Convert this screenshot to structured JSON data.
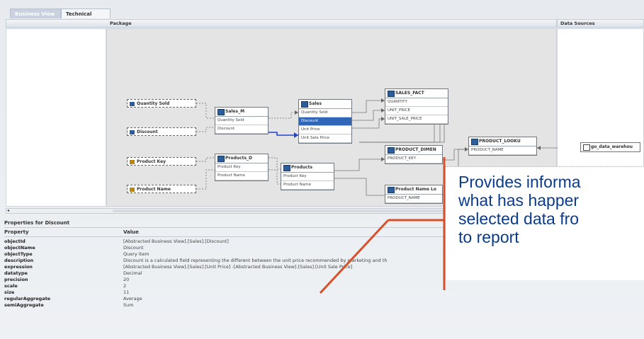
{
  "tabs": [
    {
      "label": "Business View"
    },
    {
      "label": "Technical View"
    }
  ],
  "headers": {
    "package": "Package",
    "data_sources": "Data Sources"
  },
  "query_items": [
    "Quantity Sold",
    "Discount",
    "Product Key",
    "Product Name"
  ],
  "nodes": {
    "sales_m": {
      "title": "Sales_M",
      "rows": [
        "Quantity Sold",
        "Discount"
      ]
    },
    "sales": {
      "title": "Sales",
      "rows": [
        "Quantity Sold",
        "Discount",
        "Unit Price",
        "Unit Sale Price"
      ]
    },
    "sales_fact": {
      "title": "SALES_FACT",
      "rows": [
        "QUANTITY",
        "UNIT_PRICE",
        "UNIT_SALE_PRICE"
      ]
    },
    "products_d": {
      "title": "Products_D",
      "rows": [
        "Product Key",
        "Product Name"
      ]
    },
    "products": {
      "title": "Products",
      "rows": [
        "Product Key",
        "Product Name"
      ]
    },
    "product_dimen": {
      "title": "PRODUCT_DIMEN",
      "rows": [
        "PRODUCT_KEY"
      ]
    },
    "product_name_lo": {
      "title": "Product Name Lo",
      "rows": [
        "PRODUCT_NAME"
      ]
    },
    "product_looku": {
      "title": "PRODUCT_LOOKU",
      "rows": [
        "PRODUCT_NAME"
      ]
    },
    "go_data_warehou": {
      "title": "go_data_warehou"
    }
  },
  "properties": {
    "title": "Properties for Discount",
    "col_property": "Property",
    "col_value": "Value",
    "rows": [
      {
        "k": "objectId",
        "v": "[Abstracted Business View].[Sales].[Discount]"
      },
      {
        "k": "objectName",
        "v": "Discount"
      },
      {
        "k": "objectType",
        "v": "Query Item"
      },
      {
        "k": "description",
        "v": "Discount is a calculated field representing the different between the unit price recommended by marketing and th"
      },
      {
        "k": "expression",
        "v": "[Abstracted Business View].[Sales].[Unit Price] -[Abstracted Business View].[Sales].[Unit Sale Price]"
      },
      {
        "k": "datatype",
        "v": "Decimal"
      },
      {
        "k": "precision",
        "v": "20"
      },
      {
        "k": "scale",
        "v": "2"
      },
      {
        "k": "size",
        "v": "11"
      },
      {
        "k": "regularAggregate",
        "v": "Average"
      },
      {
        "k": "semiAggregate",
        "v": "Sum"
      }
    ]
  },
  "callout": {
    "lines": [
      "Provides informa",
      "what has happer",
      "selected data fro",
      "to report"
    ]
  },
  "colors": {
    "callout_text": "#0a3b8c",
    "arrow": "#d8502a",
    "selected": "#2f66b8"
  }
}
